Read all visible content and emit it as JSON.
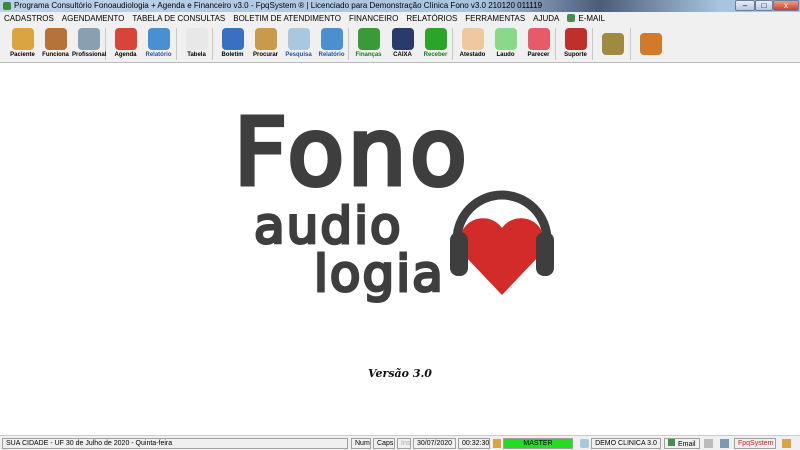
{
  "window": {
    "title": "Programa Consultório Fonoaudiologia + Agenda e Financeiro v3.0 - FpqSystem ® | Licenciado para  Demonstração Clínica Fono v3.0 210120 011119",
    "min": "–",
    "max": "□",
    "close": "x"
  },
  "menu": [
    "CADASTROS",
    "AGENDAMENTO",
    "TABELA DE CONSULTAS",
    "BOLETIM DE ATENDIMENTO",
    "FINANCEIRO",
    "RELATÓRIOS",
    "FERRAMENTAS",
    "AJUDA",
    "E-MAIL"
  ],
  "toolbar": [
    {
      "label": "Paciente",
      "color": "#d9a441"
    },
    {
      "label": "Funciona",
      "color": "#b5733a"
    },
    {
      "label": "Profissional",
      "color": "#8aa0b0"
    },
    {
      "label": "Agenda",
      "color": "#d9443a"
    },
    {
      "label": "Relatório",
      "color": "#4a8fd0"
    },
    {
      "label": "Tabela",
      "color": "#e8e8e8"
    },
    {
      "label": "Boletim",
      "color": "#3a70c0"
    },
    {
      "label": "Procurar",
      "color": "#c99a4a"
    },
    {
      "label": "Pesquisa",
      "color": "#a8c8e0"
    },
    {
      "label": "Relatório",
      "color": "#4a8fd0"
    },
    {
      "label": "Finanças",
      "color": "#3a9a3a"
    },
    {
      "label": "CAIXA",
      "color": "#2a3a6a"
    },
    {
      "label": "Receber",
      "color": "#2aa52a"
    },
    {
      "label": "Atestado",
      "color": "#f0c8a0"
    },
    {
      "label": "Laudo",
      "color": "#8ad88a"
    },
    {
      "label": "Parecer",
      "color": "#e85a6a"
    },
    {
      "label": "Suporte",
      "color": "#c0302a"
    },
    {
      "label": "",
      "color": "#a08a40"
    },
    {
      "label": "",
      "color": "#d07a2a"
    }
  ],
  "logo": {
    "line1": "Fono",
    "line2": "audio",
    "line3": "logia"
  },
  "version": "Versão 3.0",
  "status": {
    "location": "SUA CIDADE - UF 30 de Julho de 2020 - Quinta-feira",
    "num": "Num",
    "caps": "Caps",
    "ins": "Ins",
    "date": "30/07/2020",
    "time": "00:32:30",
    "user": "MASTER",
    "company": "DEMO CLINICA 3.0",
    "email": "Email",
    "brand": "FpqSystem"
  }
}
